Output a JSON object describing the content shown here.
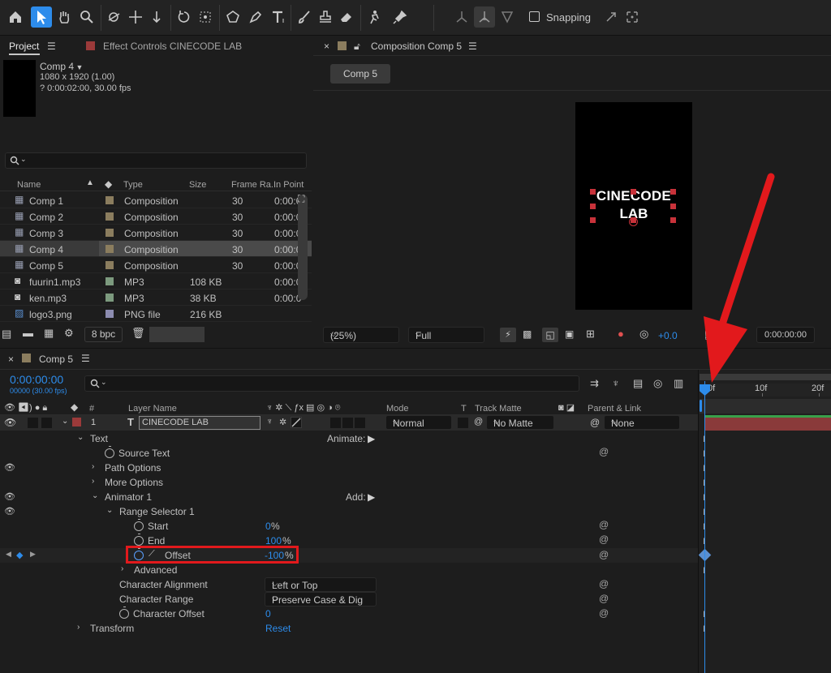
{
  "toolbar": {
    "snapping_label": "Snapping"
  },
  "project_panel": {
    "tab_project": "Project",
    "tab_effect_controls": "Effect Controls CINECODE LAB",
    "selected_name": "Comp 4",
    "selected_dims": "1080 x 1920 (1.00)",
    "selected_duration": "? 0:00:02:00, 30.00 fps",
    "columns": {
      "name": "Name",
      "type": "Type",
      "size": "Size",
      "frame_rate": "Frame Ra...",
      "in_point": "In Point"
    },
    "items": [
      {
        "name": "Comp 1",
        "type": "Composition",
        "size": "",
        "fr": "30",
        "inpt": "0:00:0"
      },
      {
        "name": "Comp 2",
        "type": "Composition",
        "size": "",
        "fr": "30",
        "inpt": "0:00:0"
      },
      {
        "name": "Comp 3",
        "type": "Composition",
        "size": "",
        "fr": "30",
        "inpt": "0:00:0"
      },
      {
        "name": "Comp 4",
        "type": "Composition",
        "size": "",
        "fr": "30",
        "inpt": "0:00:0"
      },
      {
        "name": "Comp 5",
        "type": "Composition",
        "size": "",
        "fr": "30",
        "inpt": "0:00:0"
      },
      {
        "name": "fuurin1.mp3",
        "type": "MP3",
        "size": "108 KB",
        "fr": "",
        "inpt": "0:00:0"
      },
      {
        "name": "ken.mp3",
        "type": "MP3",
        "size": "38 KB",
        "fr": "",
        "inpt": "0:00:0"
      },
      {
        "name": "logo3.png",
        "type": "PNG file",
        "size": "216 KB",
        "fr": "",
        "inpt": ""
      }
    ],
    "bpc": "8 bpc"
  },
  "composition_panel": {
    "tab_title": "Composition Comp 5",
    "comp_button": "Comp 5",
    "preview_text_line1": "CINECODE",
    "preview_text_line2": "LAB",
    "zoom": "(25%)",
    "resolution": "Full",
    "exposure": "+0.0",
    "timecode": "0:00:00:00"
  },
  "timeline": {
    "tab_title": "Comp 5",
    "timecode": "0:00:00:00",
    "frames": "00000 (30.00 fps)",
    "columns": {
      "num": "#",
      "layer_name": "Layer Name",
      "mode": "Mode",
      "t": "T",
      "track_matte": "Track Matte",
      "parent": "Parent & Link"
    },
    "layer": {
      "num": "1",
      "name": "CINECODE LAB",
      "mode": "Normal",
      "matte": "No Matte",
      "parent": "None"
    },
    "ruler": [
      "0f",
      "10f",
      "20f"
    ],
    "props": {
      "text": "Text",
      "animate": "Animate:",
      "source_text": "Source Text",
      "path_options": "Path Options",
      "more_options": "More Options",
      "animator": "Animator 1",
      "add": "Add:",
      "range_selector": "Range Selector 1",
      "start": "Start",
      "start_val": "0",
      "end": "End",
      "end_val": "100",
      "offset": "Offset",
      "offset_val": "-100",
      "percent": "%",
      "advanced": "Advanced",
      "char_alignment": "Character Alignment",
      "char_alignment_val": "Left or Top",
      "char_range": "Character Range",
      "char_range_val": "Preserve Case & Dig",
      "char_offset": "Character Offset",
      "char_offset_val": "0",
      "transform": "Transform",
      "reset": "Reset"
    }
  },
  "colors": {
    "accent": "#2d8ceb",
    "highlight": "#e2191c",
    "layer_label": "#9b3a3a",
    "comp_swatch": "#8b7d5e",
    "audio_swatch": "#7c9a7e",
    "image_swatch": "#8c8cb0"
  }
}
